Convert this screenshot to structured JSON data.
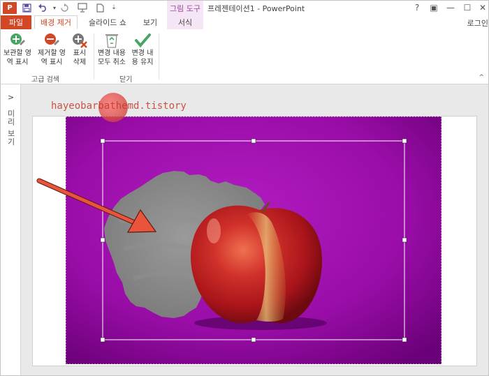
{
  "titlebar": {
    "app_title": "프레젠테이션1 - PowerPoint",
    "context_tools_label": "그림 도구",
    "logo_text": "P",
    "icons": [
      "save-icon",
      "undo-icon",
      "redo-icon",
      "slideshow-icon",
      "new-file-icon",
      "customize-icon"
    ],
    "window_buttons": [
      "?",
      "▣",
      "—",
      "☐",
      "✕"
    ]
  },
  "tabs": {
    "file": "파일",
    "items": [
      {
        "label": "배경 제거",
        "active": true
      },
      {
        "label": "슬라이드 쇼",
        "active": false
      },
      {
        "label": "보기",
        "active": false
      },
      {
        "label": "서식",
        "active": false,
        "context": true
      }
    ],
    "login": "로그인"
  },
  "ribbon": {
    "buttons": [
      {
        "line1": "보관할 영",
        "line2": "역 표시",
        "icon": "plus-pencil-icon",
        "color": "#4aa564"
      },
      {
        "line1": "제거할 영",
        "line2": "역 표시",
        "icon": "minus-pencil-icon",
        "color": "#d24726"
      },
      {
        "line1": "표시",
        "line2": "삭제",
        "icon": "delete-mark-icon",
        "color": "#777777"
      },
      {
        "line1": "변경 내용",
        "line2": "모두 취소",
        "icon": "recycle-bin-icon",
        "color": "#666666"
      },
      {
        "line1": "변경 내",
        "line2": "용 유지",
        "icon": "checkmark-icon",
        "color": "#4aa564"
      }
    ],
    "groups": {
      "refine": "고급 검색",
      "close": "닫기"
    },
    "collapse_icon": "^"
  },
  "thumbnails": {
    "chevron": ">",
    "label": "미리 보기"
  },
  "watermark": "hayeobarbathemd.tistory",
  "colors": {
    "accent": "#d24726",
    "context": "#a0449c",
    "removal_magenta": "#a010b0",
    "keep_gray": "#8a8a8a",
    "arrow": "#e8553a"
  }
}
